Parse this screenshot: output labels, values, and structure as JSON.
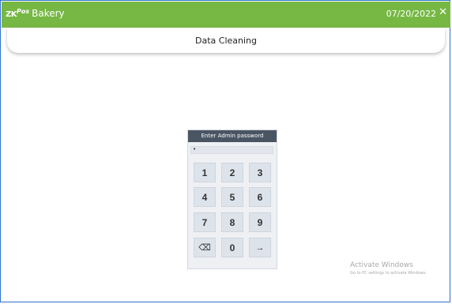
{
  "app": {
    "logo_part1": "ZK",
    "logo_part2": "Pos",
    "name": "Bakery",
    "date": "07/20/2022",
    "close_glyph": "✕"
  },
  "page": {
    "title": "Data Cleaning"
  },
  "keypad": {
    "header": "Enter Admin password",
    "masked_value": "•",
    "keys": [
      "1",
      "2",
      "3",
      "4",
      "5",
      "6",
      "7",
      "8",
      "9",
      "⌫",
      "0",
      "→"
    ]
  },
  "watermark": {
    "line1": "Activate Windows",
    "line2": "Go to PC settings to activate Windows."
  },
  "colors": {
    "topbar": "#76b843",
    "frame_border": "#2f73c9",
    "keypad_header": "#4a5564",
    "key_bg": "#dde3ea"
  }
}
